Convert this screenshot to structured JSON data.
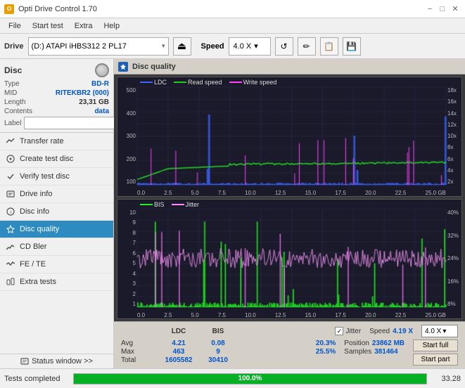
{
  "app": {
    "title": "Opti Drive Control 1.70",
    "icon": "O"
  },
  "titleControls": {
    "minimize": "−",
    "maximize": "□",
    "close": "✕"
  },
  "menu": {
    "items": [
      "File",
      "Start test",
      "Extra",
      "Help"
    ]
  },
  "drive": {
    "label": "Drive",
    "selectedDrive": "(D:)  ATAPI iHBS312  2 PL17",
    "speedLabel": "Speed",
    "selectedSpeed": "4.0 X"
  },
  "disc": {
    "title": "Disc",
    "type_key": "Type",
    "type_val": "BD-R",
    "mid_key": "MID",
    "mid_val": "RITEKBR2 (000)",
    "length_key": "Length",
    "length_val": "23,31 GB",
    "contents_key": "Contents",
    "contents_val": "data",
    "label_key": "Label",
    "label_placeholder": ""
  },
  "nav": [
    {
      "id": "transfer-rate",
      "label": "Transfer rate",
      "icon": "📊"
    },
    {
      "id": "create-test-disc",
      "label": "Create test disc",
      "icon": "💿"
    },
    {
      "id": "verify-test-disc",
      "label": "Verify test disc",
      "icon": "✔"
    },
    {
      "id": "drive-info",
      "label": "Drive info",
      "icon": "ℹ"
    },
    {
      "id": "disc-info",
      "label": "Disc info",
      "icon": "📄"
    },
    {
      "id": "disc-quality",
      "label": "Disc quality",
      "icon": "⭐",
      "active": true
    },
    {
      "id": "cd-bler",
      "label": "CD Bler",
      "icon": "📉"
    },
    {
      "id": "fe-te",
      "label": "FE / TE",
      "icon": "📈"
    },
    {
      "id": "extra-tests",
      "label": "Extra tests",
      "icon": "🔬"
    }
  ],
  "statusWindow": {
    "label": "Status window >>"
  },
  "discQuality": {
    "title": "Disc quality"
  },
  "legend1": {
    "ldc": "LDC",
    "read": "Read speed",
    "write": "Write speed"
  },
  "legend2": {
    "bis": "BIS",
    "jitter": "Jitter"
  },
  "chart1": {
    "yLeft": [
      "500",
      "400",
      "300",
      "200",
      "100"
    ],
    "yRight": [
      "18x",
      "16x",
      "14x",
      "12x",
      "10x",
      "8x",
      "6x",
      "4x",
      "2x"
    ],
    "xLabels": [
      "0.0",
      "2.5",
      "5.0",
      "7.5",
      "10.0",
      "12.5",
      "15.0",
      "17.5",
      "20.0",
      "22.5",
      "25.0 GB"
    ]
  },
  "chart2": {
    "yLeft": [
      "10",
      "9",
      "8",
      "7",
      "6",
      "5",
      "4",
      "3",
      "2",
      "1"
    ],
    "yRight": [
      "40%",
      "32%",
      "24%",
      "16%",
      "8%"
    ],
    "xLabels": [
      "0.0",
      "2.5",
      "5.0",
      "7.5",
      "10.0",
      "12.5",
      "15.0",
      "17.5",
      "20.0",
      "22.5",
      "25.0 GB"
    ]
  },
  "stats": {
    "headers": [
      "LDC",
      "BIS",
      "",
      "Jitter",
      "Speed",
      ""
    ],
    "avg_label": "Avg",
    "max_label": "Max",
    "total_label": "Total",
    "avg_ldc": "4.21",
    "avg_bis": "0.08",
    "avg_jitter": "20.3%",
    "max_ldc": "463",
    "max_bis": "9",
    "max_jitter": "25.5%",
    "total_ldc": "1605582",
    "total_bis": "30410",
    "speed_value": "4.19 X",
    "position_label": "Position",
    "position_value": "23862 MB",
    "samples_label": "Samples",
    "samples_value": "381464",
    "speed_select": "4.0 X",
    "start_full": "Start full",
    "start_part": "Start part",
    "jitter_label": "Jitter",
    "jitter_checked": true
  },
  "statusBar": {
    "text": "Tests completed",
    "progress": 100,
    "time": "33.28"
  }
}
